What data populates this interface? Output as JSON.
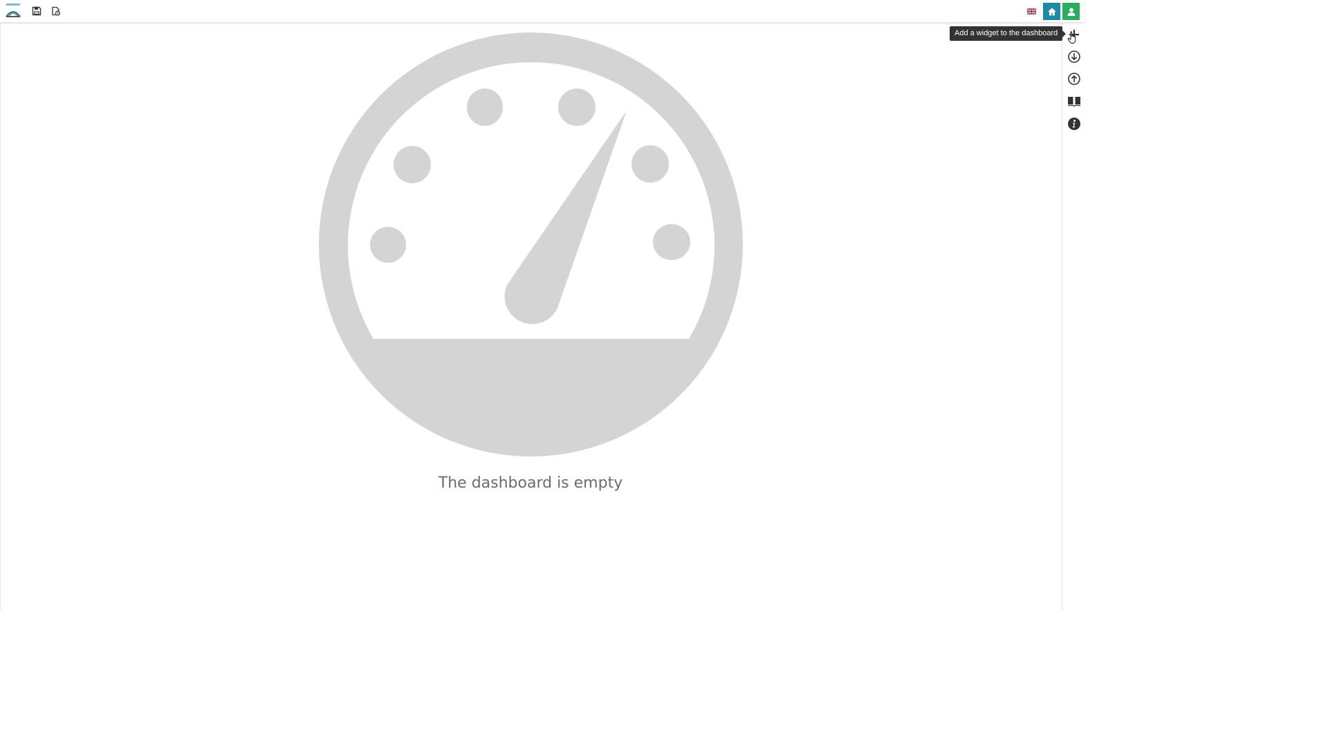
{
  "app": {
    "logo_icon": "app-logo-icon"
  },
  "toolbar": {
    "save_icon": "floppy-disk-icon",
    "save_as_icon": "save-as-document-icon",
    "language_flag": "uk-flag-icon",
    "home_icon": "home-icon",
    "user_icon": "user-icon",
    "home_color": "#1a8aa8",
    "user_color": "#2aad5f"
  },
  "sidebar": {
    "items": [
      {
        "icon": "plus-icon",
        "tooltip": "Add a widget to the dashboard"
      },
      {
        "icon": "download-circle-icon"
      },
      {
        "icon": "upload-circle-icon"
      },
      {
        "icon": "book-icon"
      },
      {
        "icon": "info-circle-icon"
      }
    ]
  },
  "dashboard": {
    "placeholder_icon": "dashboard-gauge-icon",
    "empty_message": "The dashboard is empty",
    "placeholder_color": "#d4d4d4"
  }
}
